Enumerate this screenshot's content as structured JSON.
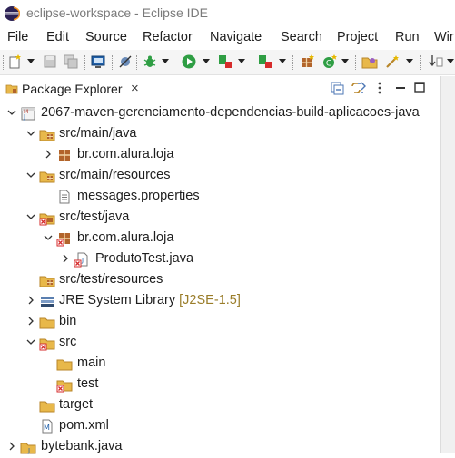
{
  "window": {
    "title": "eclipse-workspace - Eclipse IDE"
  },
  "menu": {
    "items": [
      "File",
      "Edit",
      "Source",
      "Refactor",
      "Navigate",
      "Search",
      "Project",
      "Run",
      "Wir"
    ]
  },
  "view": {
    "tab_label": "Package Explorer",
    "close_glyph": "×"
  },
  "tree": {
    "rows": [
      {
        "label": "2067-maven-gerenciamento-dependencias-build-aplicacoes-java",
        "decoration": "",
        "icon": "maven-project-icon",
        "expanded": true
      },
      {
        "label": "src/main/java",
        "decoration": "",
        "icon": "source-folder-icon",
        "expanded": true
      },
      {
        "label": "br.com.alura.loja",
        "decoration": "",
        "icon": "package-icon",
        "expanded": false
      },
      {
        "label": "src/main/resources",
        "decoration": "",
        "icon": "source-folder-icon",
        "expanded": true
      },
      {
        "label": "messages.properties",
        "decoration": "",
        "icon": "properties-file-icon",
        "expanded": null
      },
      {
        "label": "src/test/java",
        "decoration": "",
        "icon": "source-folder-error-icon",
        "expanded": true
      },
      {
        "label": "br.com.alura.loja",
        "decoration": "",
        "icon": "package-error-icon",
        "expanded": true
      },
      {
        "label": "ProdutoTest.java",
        "decoration": "",
        "icon": "java-file-error-icon",
        "expanded": false
      },
      {
        "label": "src/test/resources",
        "decoration": "",
        "icon": "source-folder-icon",
        "expanded": null
      },
      {
        "label": "JRE System Library",
        "decoration": "[J2SE-1.5]",
        "icon": "library-icon",
        "expanded": false
      },
      {
        "label": "bin",
        "decoration": "",
        "icon": "folder-icon",
        "expanded": false
      },
      {
        "label": "src",
        "decoration": "",
        "icon": "folder-error-icon",
        "expanded": true
      },
      {
        "label": "main",
        "decoration": "",
        "icon": "folder-icon",
        "expanded": null
      },
      {
        "label": "test",
        "decoration": "",
        "icon": "folder-error-icon",
        "expanded": null
      },
      {
        "label": "target",
        "decoration": "",
        "icon": "folder-icon",
        "expanded": null
      },
      {
        "label": "pom.xml",
        "decoration": "",
        "icon": "maven-pom-icon",
        "expanded": null
      },
      {
        "label": "bytebank.java",
        "decoration": "",
        "icon": "java-project-icon",
        "expanded": false
      }
    ]
  },
  "colors": {
    "folder": "#e8b84a",
    "package": "#b2642b",
    "error": "#d62b2b",
    "run": "#2f9e44",
    "decoration": "#9a7d2a"
  }
}
